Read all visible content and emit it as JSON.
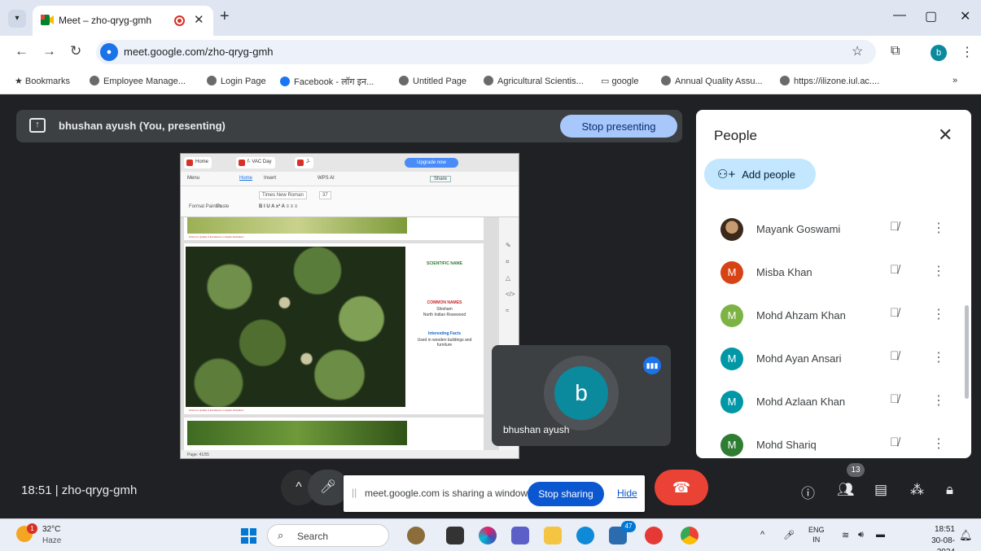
{
  "browser": {
    "tab_title": "Meet – zho-qryg-gmh",
    "tab_close": "✕",
    "new_tab": "+",
    "url": "meet.google.com/zho-qryg-gmh",
    "profile_initial": "b",
    "bookmarks": [
      {
        "label": "Bookmarks"
      },
      {
        "label": "Employee Manage..."
      },
      {
        "label": "Login Page"
      },
      {
        "label": "Facebook - लॉग इन..."
      },
      {
        "label": "Untitled Page"
      },
      {
        "label": "Agricultural Scientis..."
      },
      {
        "label": "google"
      },
      {
        "label": "Annual Quality Assu..."
      },
      {
        "label": "https://ilizone.iul.ac...."
      }
    ],
    "bookmarks_more": "»"
  },
  "meet": {
    "presenting_text": "bhushan ayush (You, presenting)",
    "stop_presenting": "Stop presenting",
    "self_name": "bhushan ayush",
    "self_initial": "b",
    "time": "18:51",
    "meeting_code": "zho-qryg-gmh",
    "participant_count": "13",
    "share_notice": "meet.google.com is sharing a window.",
    "stop_sharing": "Stop sharing",
    "hide": "Hide"
  },
  "shared_window": {
    "tabs": [
      "Home",
      "f- VAC Day",
      "J-"
    ],
    "upgrade": "Upgrade now",
    "menu": [
      "Menu",
      "Home",
      "Insert",
      "WPS AI"
    ],
    "share": "Share",
    "ribbon_font": "Times New Roman",
    "ribbon_size": "37",
    "ribbon_labels": [
      "Format Painter",
      "Paste"
    ],
    "doc_footer": "Strive for Quality & Excellence in Higher Education",
    "scientific_name": "SCIENTIFIC NAME",
    "common_names": "COMMON NAMES",
    "common_name_1": "Shisham",
    "common_name_2": "North Indian Rosewood",
    "interesting_facts": "Interesting Facts",
    "fact_1": "Used in wooden buildings and furniture",
    "status_page": "Page: 41/55"
  },
  "people_panel": {
    "title": "People",
    "add_people": "Add people",
    "participants": [
      {
        "name": "Mayank Goswami",
        "initial": "",
        "color": "#7a5c3e",
        "photo": true
      },
      {
        "name": "Misba Khan",
        "initial": "M",
        "color": "#d84315"
      },
      {
        "name": "Mohd Ahzam Khan",
        "initial": "M",
        "color": "#7cb342"
      },
      {
        "name": "Mohd Ayan Ansari",
        "initial": "M",
        "color": "#0097a7"
      },
      {
        "name": "Mohd Azlaan Khan",
        "initial": "M",
        "color": "#0097a7"
      },
      {
        "name": "Mohd Shariq",
        "initial": "M",
        "color": "#2e7d32"
      }
    ]
  },
  "taskbar": {
    "temperature": "32°C",
    "weather": "Haze",
    "weather_alert": "1",
    "search": "Search",
    "app_badge": "47",
    "lang_1": "ENG",
    "lang_2": "IN",
    "clock_time": "18:51",
    "clock_date": "30-08-2024"
  }
}
